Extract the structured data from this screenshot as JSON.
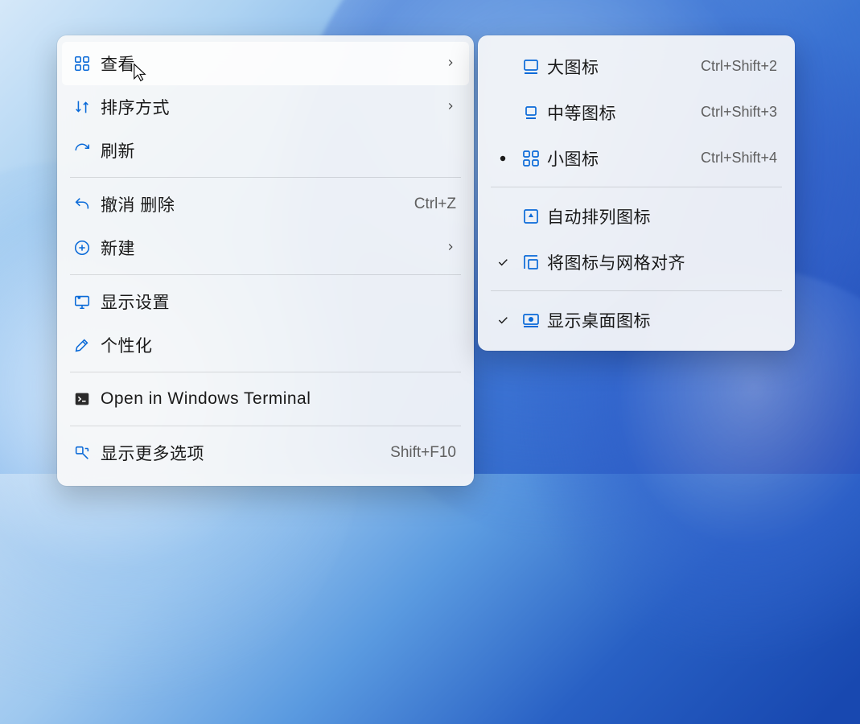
{
  "mainMenu": {
    "items": [
      {
        "id": "view",
        "label": "查看",
        "hasSubmenu": true,
        "hovered": true
      },
      {
        "id": "sort",
        "label": "排序方式",
        "hasSubmenu": true
      },
      {
        "id": "refresh",
        "label": "刷新"
      },
      {
        "sep": true
      },
      {
        "id": "undo",
        "label": "撤消 删除",
        "shortcut": "Ctrl+Z"
      },
      {
        "id": "new",
        "label": "新建",
        "hasSubmenu": true
      },
      {
        "sep": true
      },
      {
        "id": "display",
        "label": "显示设置"
      },
      {
        "id": "personalize",
        "label": "个性化"
      },
      {
        "sep": true
      },
      {
        "id": "terminal",
        "label": "Open in Windows Terminal"
      },
      {
        "sep": true
      },
      {
        "id": "more",
        "label": "显示更多选项",
        "shortcut": "Shift+F10"
      }
    ]
  },
  "subMenu": {
    "items": [
      {
        "id": "large",
        "label": "大图标",
        "shortcut": "Ctrl+Shift+2"
      },
      {
        "id": "medium",
        "label": "中等图标",
        "shortcut": "Ctrl+Shift+3"
      },
      {
        "id": "small",
        "label": "小图标",
        "shortcut": "Ctrl+Shift+4",
        "selected": "dot"
      },
      {
        "sep": true
      },
      {
        "id": "autoarrange",
        "label": "自动排列图标"
      },
      {
        "id": "align",
        "label": "将图标与网格对齐",
        "selected": "check"
      },
      {
        "sep": true
      },
      {
        "id": "showicons",
        "label": "显示桌面图标",
        "selected": "check"
      }
    ]
  }
}
